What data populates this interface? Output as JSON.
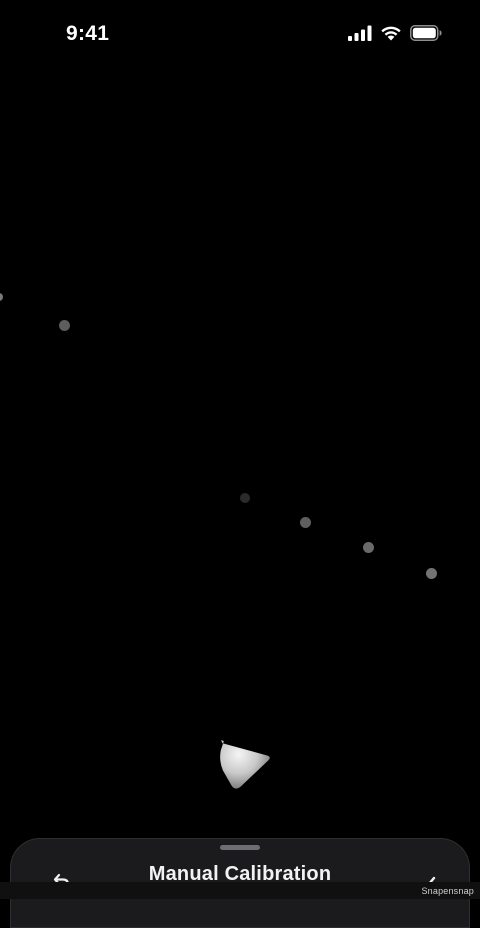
{
  "status_bar": {
    "time": "9:41",
    "icons": [
      "cellular-signal-icon",
      "wifi-icon",
      "battery-icon"
    ]
  },
  "scene": {
    "background": "#000000",
    "dots": [
      {
        "name": "calibration-point-1",
        "color": "#7a7a7a"
      },
      {
        "name": "calibration-point-2",
        "color": "#5d5d5d"
      },
      {
        "name": "calibration-point-3",
        "color": "#2b2b2b"
      },
      {
        "name": "calibration-point-4",
        "color": "#5f5f5f"
      },
      {
        "name": "calibration-point-5",
        "color": "#6a6a6a"
      },
      {
        "name": "calibration-point-6",
        "color": "#737373"
      }
    ],
    "pointer_icon": "aim-pointer-icon"
  },
  "sheet": {
    "title": "Manual Calibration",
    "undo_icon": "undo-icon",
    "confirm_icon": "checkmark-icon",
    "background": "#1b1b1d"
  },
  "watermark": "Snapensnap"
}
